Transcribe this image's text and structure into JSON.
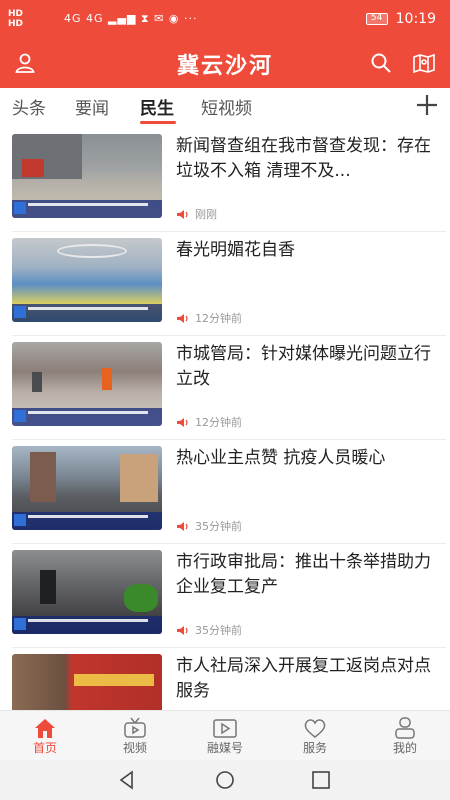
{
  "status_bar": {
    "left_text": "4G 4G",
    "hd1": "HD",
    "hd2": "HD",
    "battery": "54",
    "time": "10:19"
  },
  "app": {
    "title": "冀云沙河",
    "accent_color": "#ee4b3b"
  },
  "tabs": [
    {
      "label": "头条"
    },
    {
      "label": "要闻"
    },
    {
      "label": "民生",
      "active": true
    },
    {
      "label": "短视频"
    }
  ],
  "feed": [
    {
      "title": "新闻督查组在我市督查发现：存在垃圾不入箱 清理不及...",
      "time": "刚刚"
    },
    {
      "title": "春光明媚花自香",
      "time": "12分钟前"
    },
    {
      "title": "市城管局：针对媒体曝光问题立行立改",
      "time": "12分钟前"
    },
    {
      "title": "热心业主点赞 抗疫人员暖心",
      "time": "35分钟前"
    },
    {
      "title": "市行政审批局：推出十条举措助力企业复工复产",
      "time": "35分钟前"
    },
    {
      "title": "市人社局深入开展复工返岗点对点服务",
      "time": ""
    }
  ],
  "bottom_nav": [
    {
      "label": "首页",
      "icon": "home-icon",
      "active": true
    },
    {
      "label": "视频",
      "icon": "tv-icon"
    },
    {
      "label": "融媒号",
      "icon": "video-play-icon"
    },
    {
      "label": "服务",
      "icon": "heart-icon"
    },
    {
      "label": "我的",
      "icon": "person-icon"
    }
  ]
}
